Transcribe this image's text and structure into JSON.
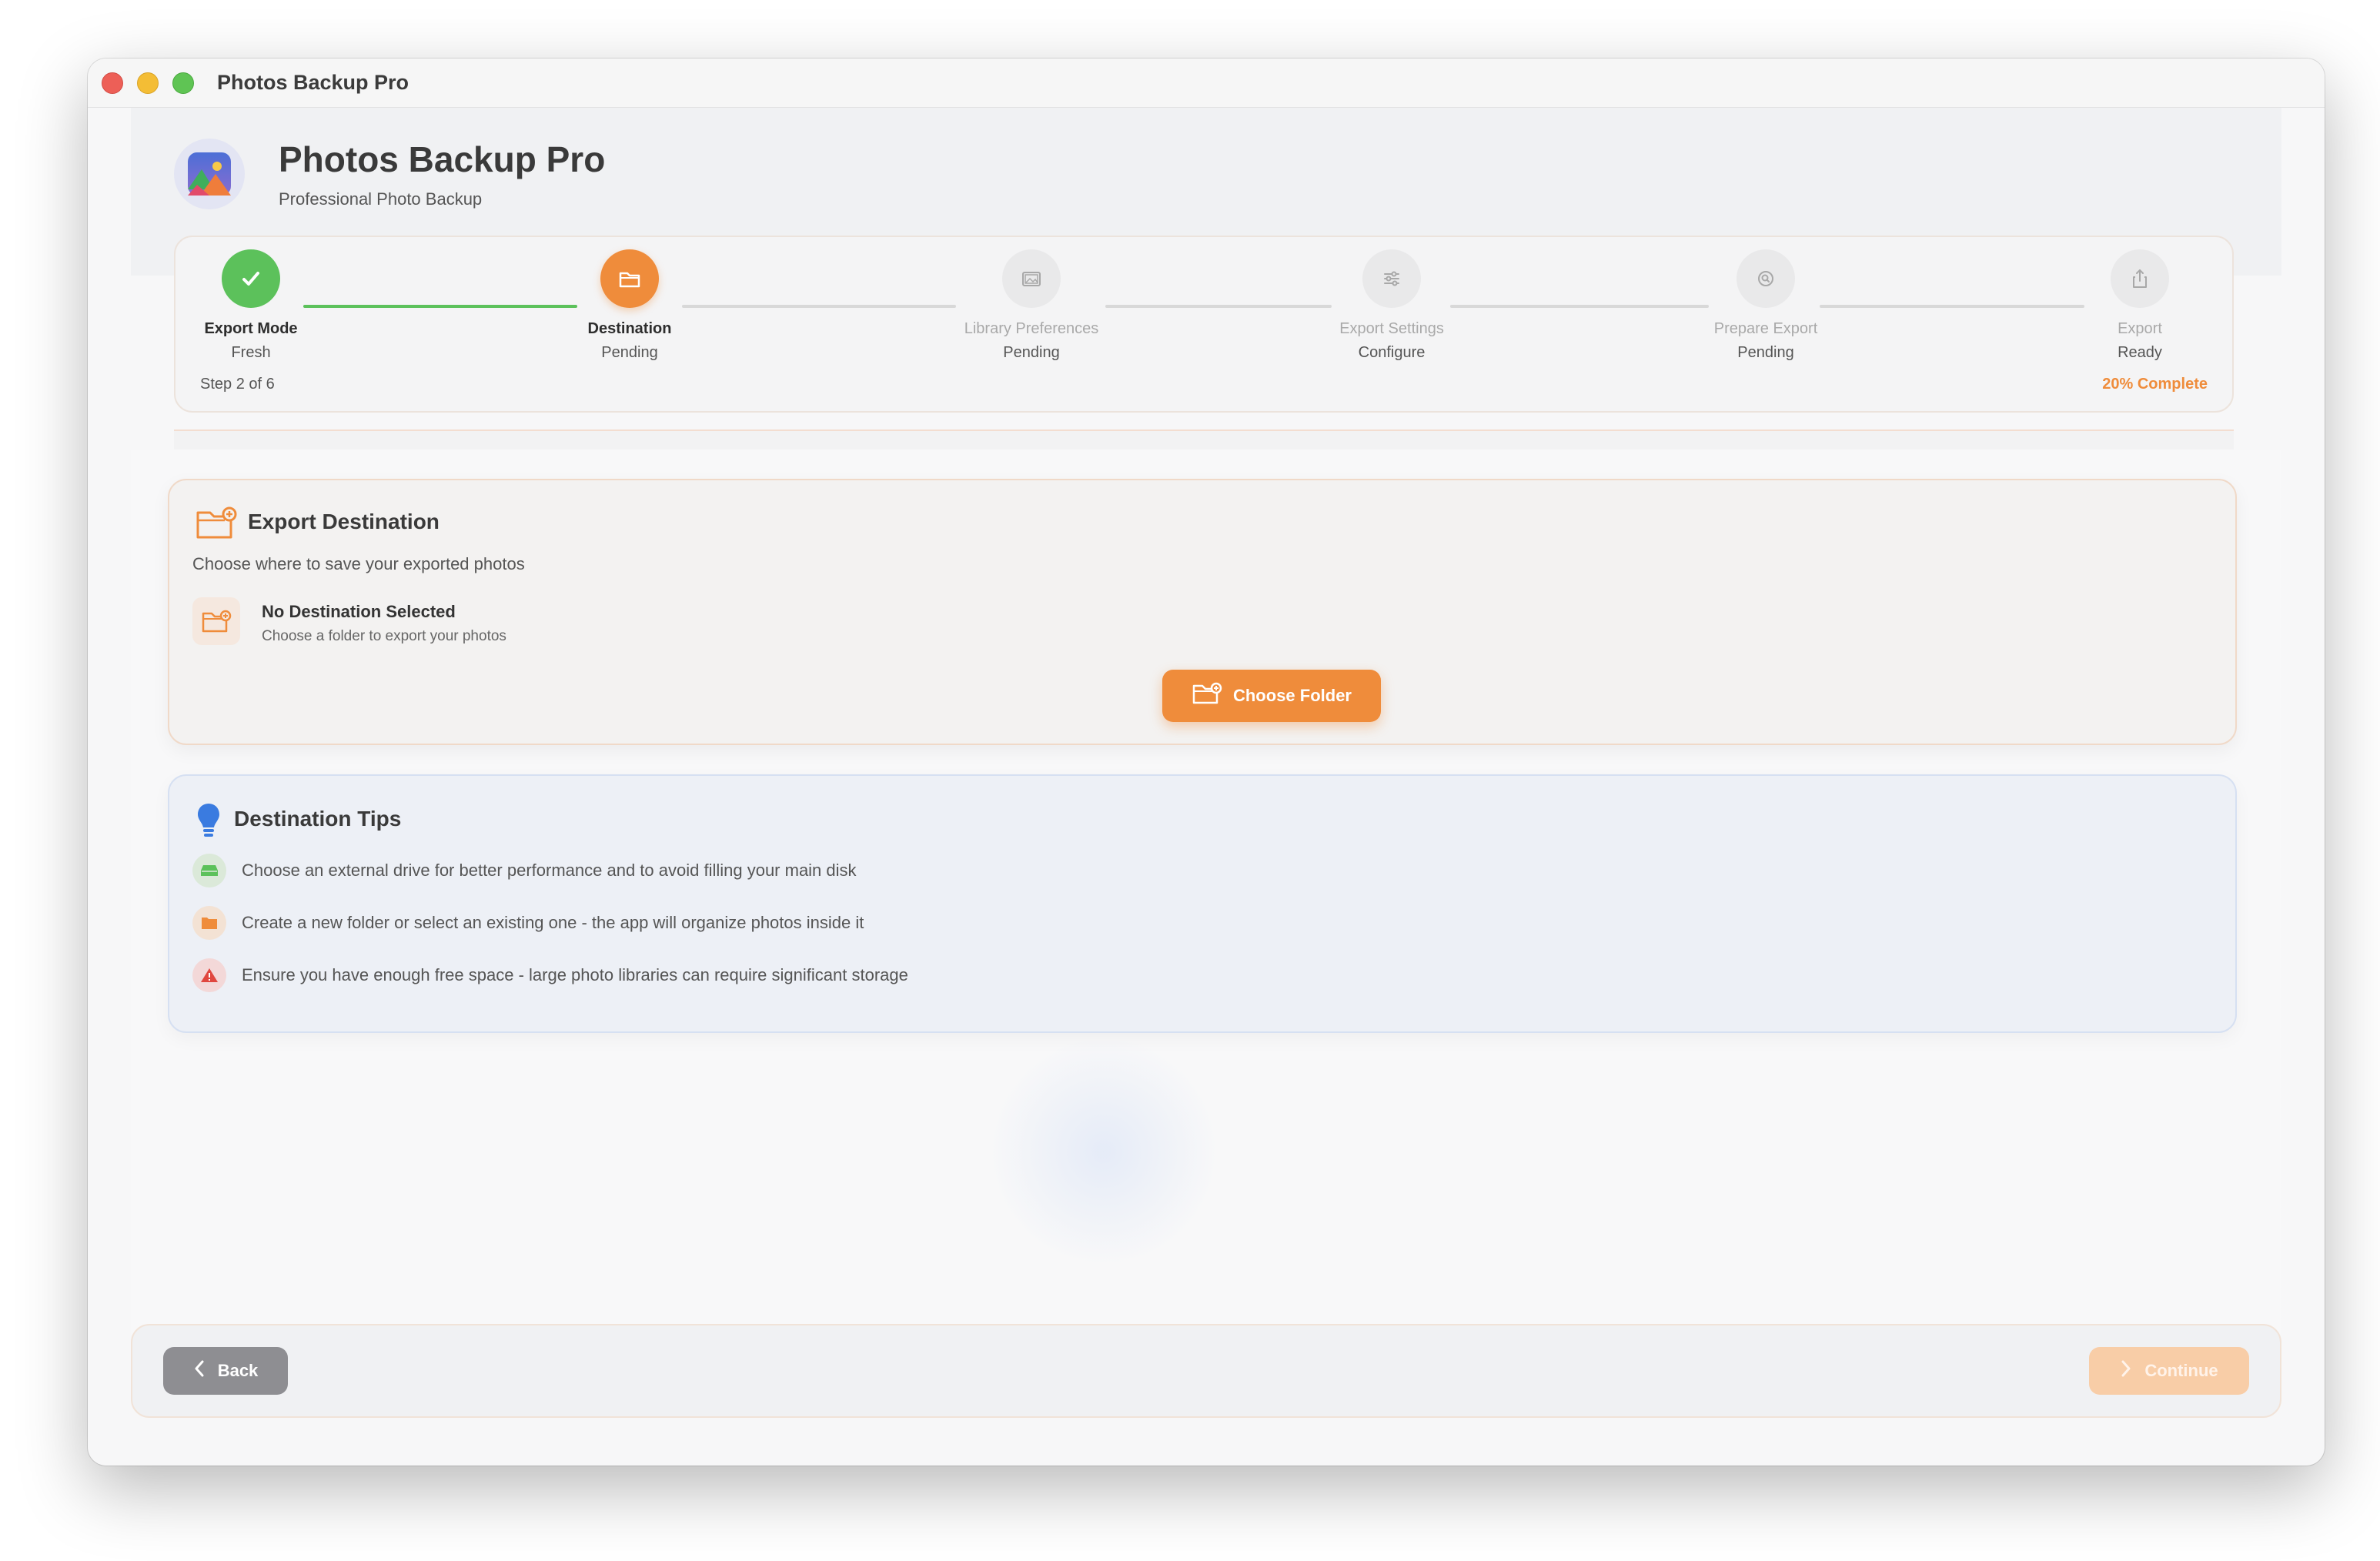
{
  "window": {
    "title": "Photos Backup Pro"
  },
  "header": {
    "title": "Photos Backup Pro",
    "subtitle": "Professional Photo Backup"
  },
  "stepper": {
    "steps": [
      {
        "name": "Export Mode",
        "status": "Fresh",
        "state": "done",
        "icon": "checkmark-icon"
      },
      {
        "name": "Destination",
        "status": "Pending",
        "state": "active",
        "icon": "folder-icon"
      },
      {
        "name": "Library Preferences",
        "status": "Pending",
        "state": "upcoming",
        "icon": "photo-library-icon"
      },
      {
        "name": "Export Settings",
        "status": "Configure",
        "state": "upcoming",
        "icon": "sliders-icon"
      },
      {
        "name": "Prepare Export",
        "status": "Pending",
        "state": "upcoming",
        "icon": "magnifier-icon"
      },
      {
        "name": "Export",
        "status": "Ready",
        "state": "upcoming",
        "icon": "share-icon"
      }
    ],
    "step_count": "Step 2 of 6",
    "percent_label": "20% Complete",
    "progress_fraction": 0.2
  },
  "destination": {
    "title": "Export Destination",
    "subtitle": "Choose where to save your exported photos",
    "empty_title": "No Destination Selected",
    "empty_subtitle": "Choose a folder to export your photos",
    "choose_button": "Choose Folder"
  },
  "tips": {
    "title": "Destination Tips",
    "items": [
      {
        "icon": "external-drive-icon",
        "text": "Choose an external drive for better performance and to avoid filling your main disk"
      },
      {
        "icon": "folder-icon",
        "text": "Create a new folder or select an existing one - the app will organize photos inside it"
      },
      {
        "icon": "warning-icon",
        "text": "Ensure you have enough free space - large photo libraries can require significant storage"
      }
    ]
  },
  "footer": {
    "back": "Back",
    "continue": "Continue"
  },
  "colors": {
    "accent": "#ef8c3b",
    "success": "#5cc15b",
    "tip_blue": "#3a7be0",
    "warning": "#e0473f"
  }
}
